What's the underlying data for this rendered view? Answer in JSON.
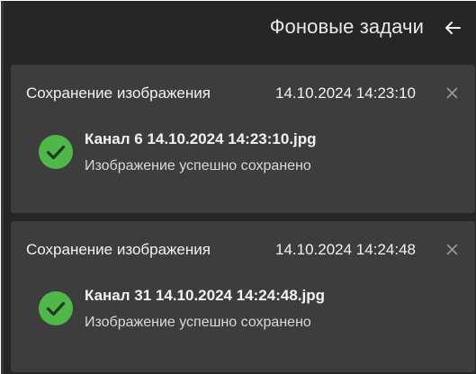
{
  "header": {
    "title": "Фоновые задачи",
    "back_icon": "arrow-left-icon"
  },
  "tasks": [
    {
      "title": "Сохранение изображения",
      "time": "14.10.2024 14:23:10",
      "file": "Канал 6 14.10.2024 14:23:10.jpg",
      "status": "Изображение успешно сохранено",
      "status_icon": "check-circle-icon"
    },
    {
      "title": "Сохранение изображения",
      "time": "14.10.2024 14:24:48",
      "file": "Канал 31 14.10.2024 14:24:48.jpg",
      "status": "Изображение успешно сохранено",
      "status_icon": "check-circle-icon"
    }
  ],
  "colors": {
    "panel_bg": "#262626",
    "card_bg": "#3d3d3d",
    "success": "#4fb848",
    "text": "#f2f2f2"
  }
}
